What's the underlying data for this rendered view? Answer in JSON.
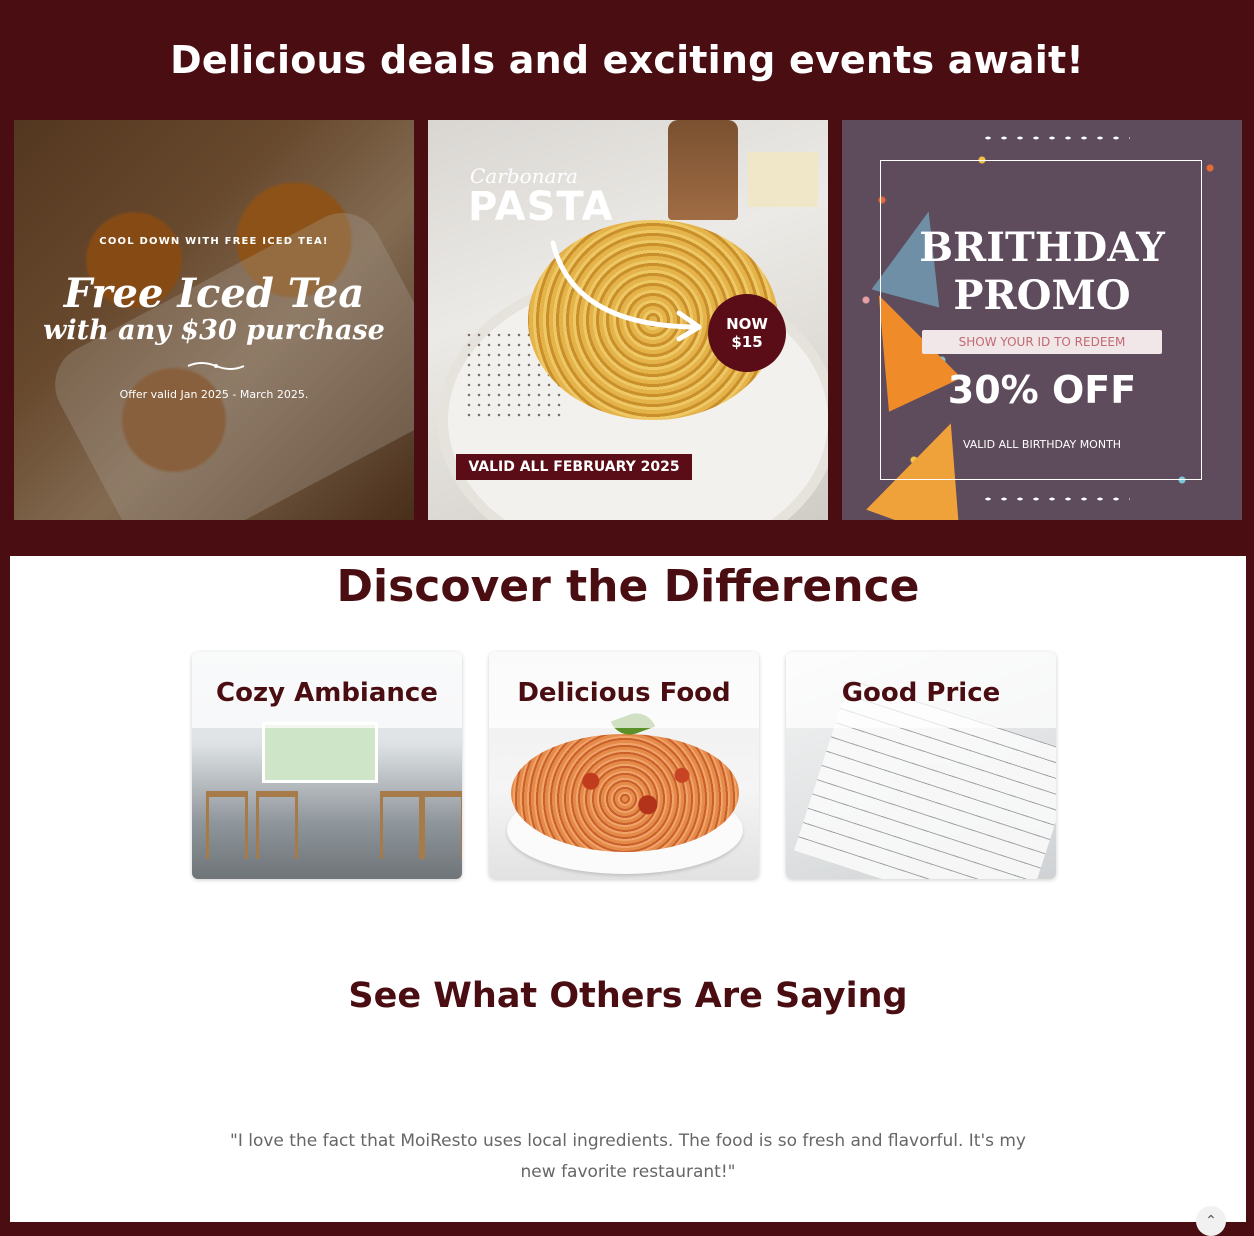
{
  "promo": {
    "heading": "Delicious deals and exciting events await!",
    "iced_tea": {
      "tagline": "COOL DOWN WITH FREE ICED TEA!",
      "title": "Free Iced Tea",
      "subtitle": "with any $30 purchase",
      "validity": "Offer valid Jan 2025 - March 2025."
    },
    "pasta": {
      "script": "Carbonara",
      "title": "PASTA",
      "badge_line1": "NOW",
      "badge_line2": "$15",
      "validity": "VALID ALL FEBRUARY 2025"
    },
    "birthday": {
      "title_line1": "BRITHDAY",
      "title_line2": "PROMO",
      "redeem": "SHOW YOUR ID TO REDEEM",
      "discount": "30% OFF",
      "validity": "VALID ALL BIRTHDAY MONTH"
    }
  },
  "difference": {
    "heading": "Discover the Difference",
    "cards": [
      {
        "label": "Cozy Ambiance"
      },
      {
        "label": "Delicious Food"
      },
      {
        "label": "Good Price"
      }
    ]
  },
  "testimonials": {
    "heading": "See What Others Are Saying",
    "quote": "\"I love the fact that MoiResto uses local ingredients. The food is so fresh and flavorful. It's my new favorite restaurant!\""
  },
  "colors": {
    "brand_maroon": "#4a0d12",
    "badge_maroon": "#5a0d16"
  },
  "icons": {
    "scroll_top": "chevron-up-icon"
  }
}
